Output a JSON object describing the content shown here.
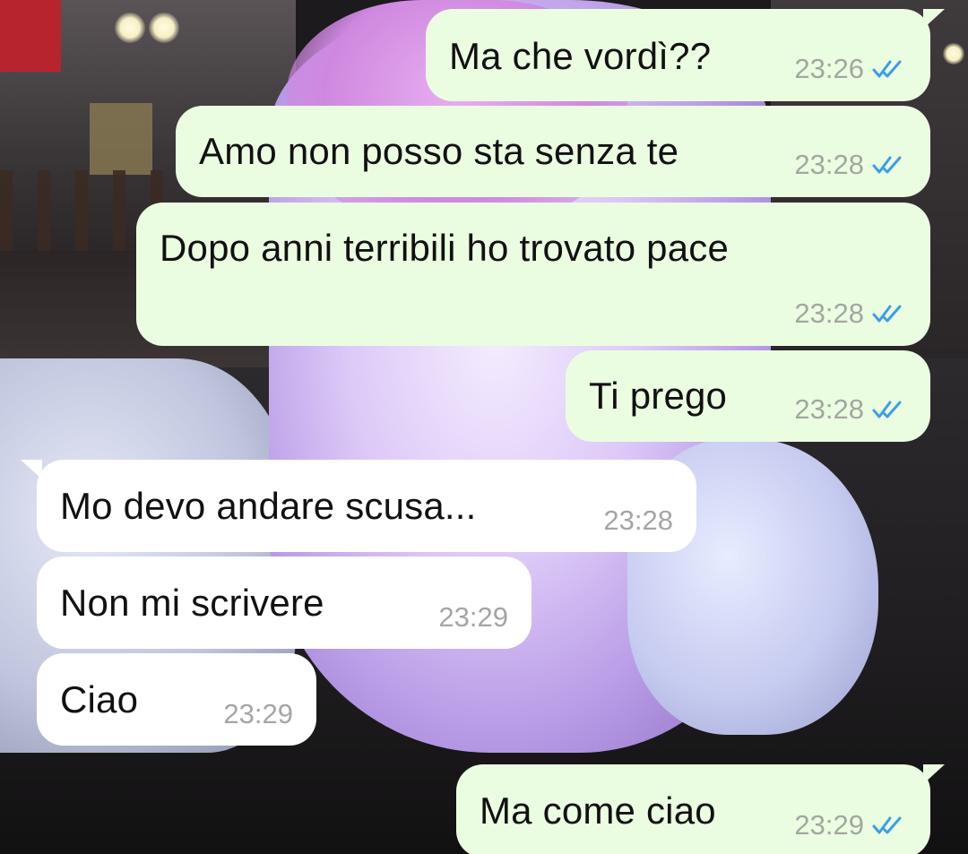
{
  "conversation": {
    "messages": [
      {
        "direction": "outgoing",
        "text": "Ma che vordì??",
        "time": "23:26",
        "status": "read",
        "status_icon": "double-check-icon"
      },
      {
        "direction": "outgoing",
        "text": "Amo non posso sta senza te",
        "time": "23:28",
        "status": "read",
        "status_icon": "double-check-icon"
      },
      {
        "direction": "outgoing",
        "text": "Dopo anni terribili ho trovato pace",
        "time": "23:28",
        "status": "read",
        "status_icon": "double-check-icon"
      },
      {
        "direction": "outgoing",
        "text": "Ti prego",
        "time": "23:28",
        "status": "read",
        "status_icon": "double-check-icon"
      },
      {
        "direction": "incoming",
        "text": "Mo devo andare scusa...",
        "time": "23:28"
      },
      {
        "direction": "incoming",
        "text": "Non mi scrivere",
        "time": "23:29"
      },
      {
        "direction": "incoming",
        "text": "Ciao",
        "time": "23:29"
      },
      {
        "direction": "outgoing",
        "text": "Ma come ciao",
        "time": "23:29",
        "status": "read",
        "status_icon": "double-check-icon"
      }
    ]
  },
  "colors": {
    "outgoing_bubble": "#ebfde1",
    "incoming_bubble": "#ffffff",
    "message_text": "#111111",
    "timestamp": "#a3a6a2",
    "read_ticks": "#3c9ee6"
  }
}
